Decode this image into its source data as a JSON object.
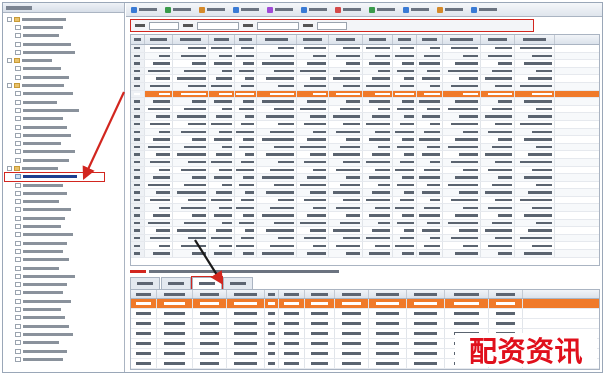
{
  "watermark": {
    "text": "配资资讯"
  },
  "colors": {
    "highlight_row": "#f07a2a",
    "annotation_red": "#d2261f",
    "watermark_red": "#e0101c"
  },
  "sidebar": {
    "header_label": "",
    "nodes": [
      {
        "level": 0,
        "icon": "folder-icon",
        "label": ""
      },
      {
        "level": 1,
        "icon": "doc-icon",
        "label": ""
      },
      {
        "level": 1,
        "icon": "doc-icon",
        "label": ""
      },
      {
        "level": 1,
        "icon": "doc-icon",
        "label": ""
      },
      {
        "level": 1,
        "icon": "doc-icon",
        "label": ""
      },
      {
        "level": 0,
        "icon": "folder-icon",
        "label": ""
      },
      {
        "level": 1,
        "icon": "doc-icon",
        "label": ""
      },
      {
        "level": 1,
        "icon": "doc-icon",
        "label": ""
      },
      {
        "level": 0,
        "icon": "folder-icon",
        "label": ""
      },
      {
        "level": 1,
        "icon": "doc-icon",
        "label": ""
      },
      {
        "level": 1,
        "icon": "doc-icon",
        "label": ""
      },
      {
        "level": 1,
        "icon": "doc-icon",
        "label": ""
      },
      {
        "level": 1,
        "icon": "doc-icon",
        "label": ""
      },
      {
        "level": 1,
        "icon": "doc-icon",
        "label": ""
      },
      {
        "level": 1,
        "icon": "doc-icon",
        "label": ""
      },
      {
        "level": 1,
        "icon": "doc-icon",
        "label": ""
      },
      {
        "level": 1,
        "icon": "doc-icon",
        "label": ""
      },
      {
        "level": 1,
        "icon": "doc-icon",
        "label": ""
      },
      {
        "level": 0,
        "icon": "folder-icon",
        "label": ""
      },
      {
        "level": 1,
        "icon": "grid-icon",
        "label": "",
        "selected": true
      },
      {
        "level": 1,
        "icon": "doc-icon",
        "label": ""
      },
      {
        "level": 1,
        "icon": "doc-icon",
        "label": ""
      },
      {
        "level": 1,
        "icon": "doc-icon",
        "label": ""
      },
      {
        "level": 1,
        "icon": "doc-icon",
        "label": ""
      },
      {
        "level": 1,
        "icon": "doc-icon",
        "label": ""
      },
      {
        "level": 1,
        "icon": "doc-icon",
        "label": ""
      },
      {
        "level": 1,
        "icon": "doc-icon",
        "label": ""
      },
      {
        "level": 1,
        "icon": "doc-icon",
        "label": ""
      },
      {
        "level": 1,
        "icon": "doc-icon",
        "label": ""
      },
      {
        "level": 1,
        "icon": "doc-icon",
        "label": ""
      },
      {
        "level": 1,
        "icon": "doc-icon",
        "label": ""
      },
      {
        "level": 1,
        "icon": "doc-icon",
        "label": ""
      },
      {
        "level": 1,
        "icon": "doc-icon",
        "label": ""
      },
      {
        "level": 1,
        "icon": "doc-icon",
        "label": ""
      },
      {
        "level": 1,
        "icon": "doc-icon",
        "label": ""
      },
      {
        "level": 1,
        "icon": "doc-icon",
        "label": ""
      },
      {
        "level": 1,
        "icon": "doc-icon",
        "label": ""
      },
      {
        "level": 1,
        "icon": "doc-icon",
        "label": ""
      },
      {
        "level": 1,
        "icon": "doc-icon",
        "label": ""
      },
      {
        "level": 1,
        "icon": "doc-icon",
        "label": ""
      },
      {
        "level": 1,
        "icon": "doc-icon",
        "label": ""
      },
      {
        "level": 1,
        "icon": "doc-icon",
        "label": ""
      }
    ]
  },
  "toolbar": {
    "buttons": [
      {
        "name": "tb-button-1",
        "icon_color": "#3a7bd5"
      },
      {
        "name": "tb-button-2",
        "icon_color": "#3a9b4b"
      },
      {
        "name": "tb-button-3",
        "icon_color": "#d58a2a"
      },
      {
        "name": "tb-button-4",
        "icon_color": "#3a7bd5"
      },
      {
        "name": "tb-button-5",
        "icon_color": "#a04ad5"
      },
      {
        "name": "tb-button-6",
        "icon_color": "#3a7bd5"
      },
      {
        "name": "tb-button-7",
        "icon_color": "#d54a4a"
      },
      {
        "name": "tb-button-8",
        "icon_color": "#3a9b4b"
      },
      {
        "name": "tb-button-9",
        "icon_color": "#3a7bd5"
      },
      {
        "name": "tb-button-10",
        "icon_color": "#d58a2a"
      },
      {
        "name": "tb-button-11",
        "icon_color": "#3a7bd5"
      }
    ]
  },
  "filter": {
    "fields": [
      {
        "name": "filter-type-select",
        "label": "",
        "value": ""
      },
      {
        "name": "filter-start-date",
        "label": "",
        "value": ""
      },
      {
        "name": "filter-end-date",
        "label": "",
        "value": ""
      },
      {
        "name": "filter-mode-select",
        "label": "",
        "value": ""
      }
    ]
  },
  "top_grid": {
    "columns": 14,
    "rows": 28,
    "selected_row": 6
  },
  "notice": {
    "prefix": "",
    "text": ""
  },
  "tabs": [
    {
      "label": "",
      "active": false
    },
    {
      "label": "",
      "active": false
    },
    {
      "label": "",
      "active": true
    },
    {
      "label": "",
      "active": false
    }
  ],
  "bottom_grid": {
    "columns": 12,
    "rows": 7,
    "selected_row": 0
  }
}
